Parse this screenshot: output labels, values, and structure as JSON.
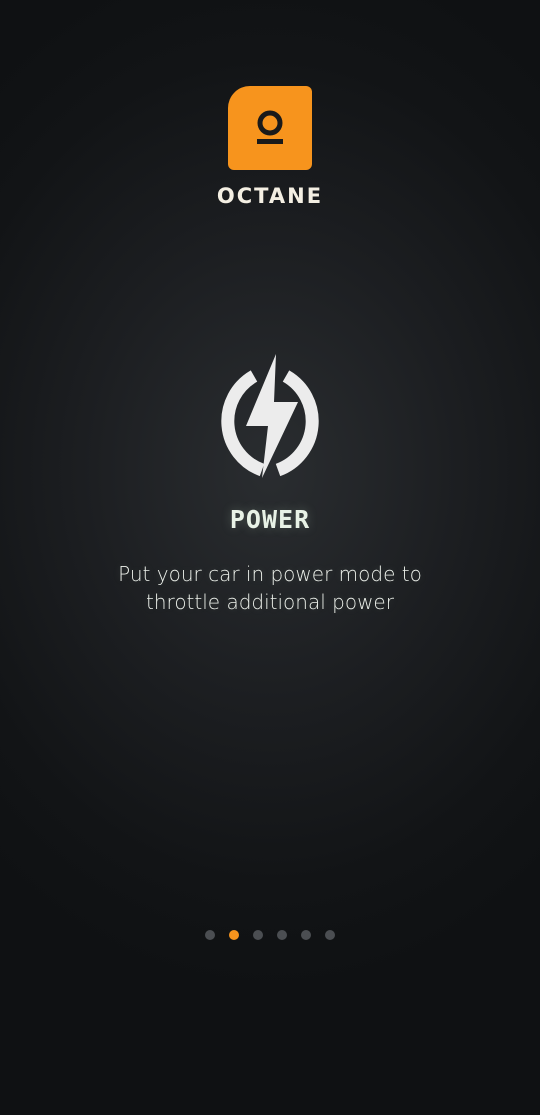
{
  "brand": {
    "name": "OCTANE",
    "accent_color": "#f7941d",
    "logo_icon": "octane-logo-icon"
  },
  "feature": {
    "icon": "power-bolt-icon",
    "title": "POWER",
    "description": "Put your car in power mode to throttle additional power"
  },
  "pager": {
    "total": 6,
    "active_index": 1,
    "active_color": "#f7941d",
    "inactive_color": "#4b4e52"
  }
}
